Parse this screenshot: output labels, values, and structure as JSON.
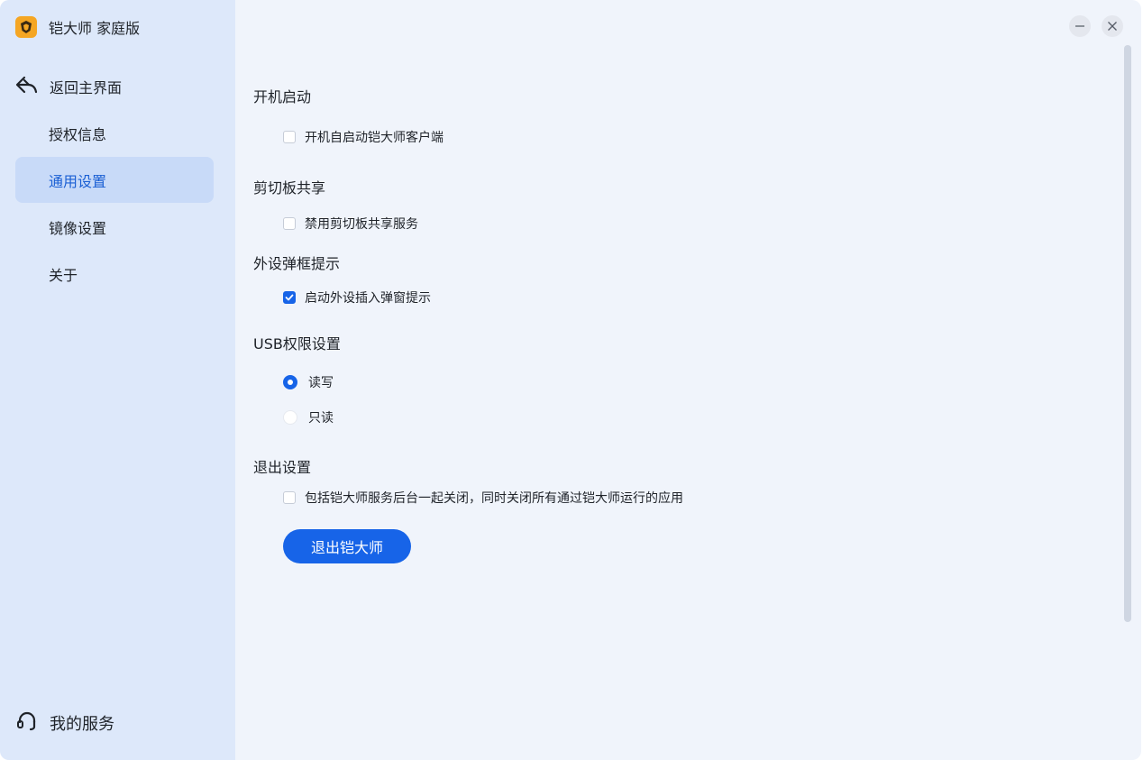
{
  "app": {
    "title": "铠大师 家庭版",
    "logo_icon": "shield-logo-icon",
    "accent": "#1764e8"
  },
  "sidebar": {
    "back_label": "返回主界面",
    "items": [
      {
        "label": "授权信息",
        "active": false
      },
      {
        "label": "通用设置",
        "active": true
      },
      {
        "label": "镜像设置",
        "active": false
      },
      {
        "label": "关于",
        "active": false
      }
    ],
    "service_label": "我的服务"
  },
  "settings": {
    "startup": {
      "title": "开机启动",
      "option_label": "开机自启动铠大师客户端",
      "checked": false
    },
    "clipboard": {
      "title": "剪切板共享",
      "option_label": "禁用剪切板共享服务",
      "checked": false
    },
    "peripheral": {
      "title": "外设弹框提示",
      "option_label": "启动外设插入弹窗提示",
      "checked": true
    },
    "usb": {
      "title": "USB权限设置",
      "options": [
        {
          "label": "读写",
          "selected": true
        },
        {
          "label": "只读",
          "selected": false
        }
      ]
    },
    "exit": {
      "title": "退出设置",
      "option_label": "包括铠大师服务后台一起关闭，同时关闭所有通过铠大师运行的应用",
      "checked": false,
      "button_label": "退出铠大师"
    }
  }
}
